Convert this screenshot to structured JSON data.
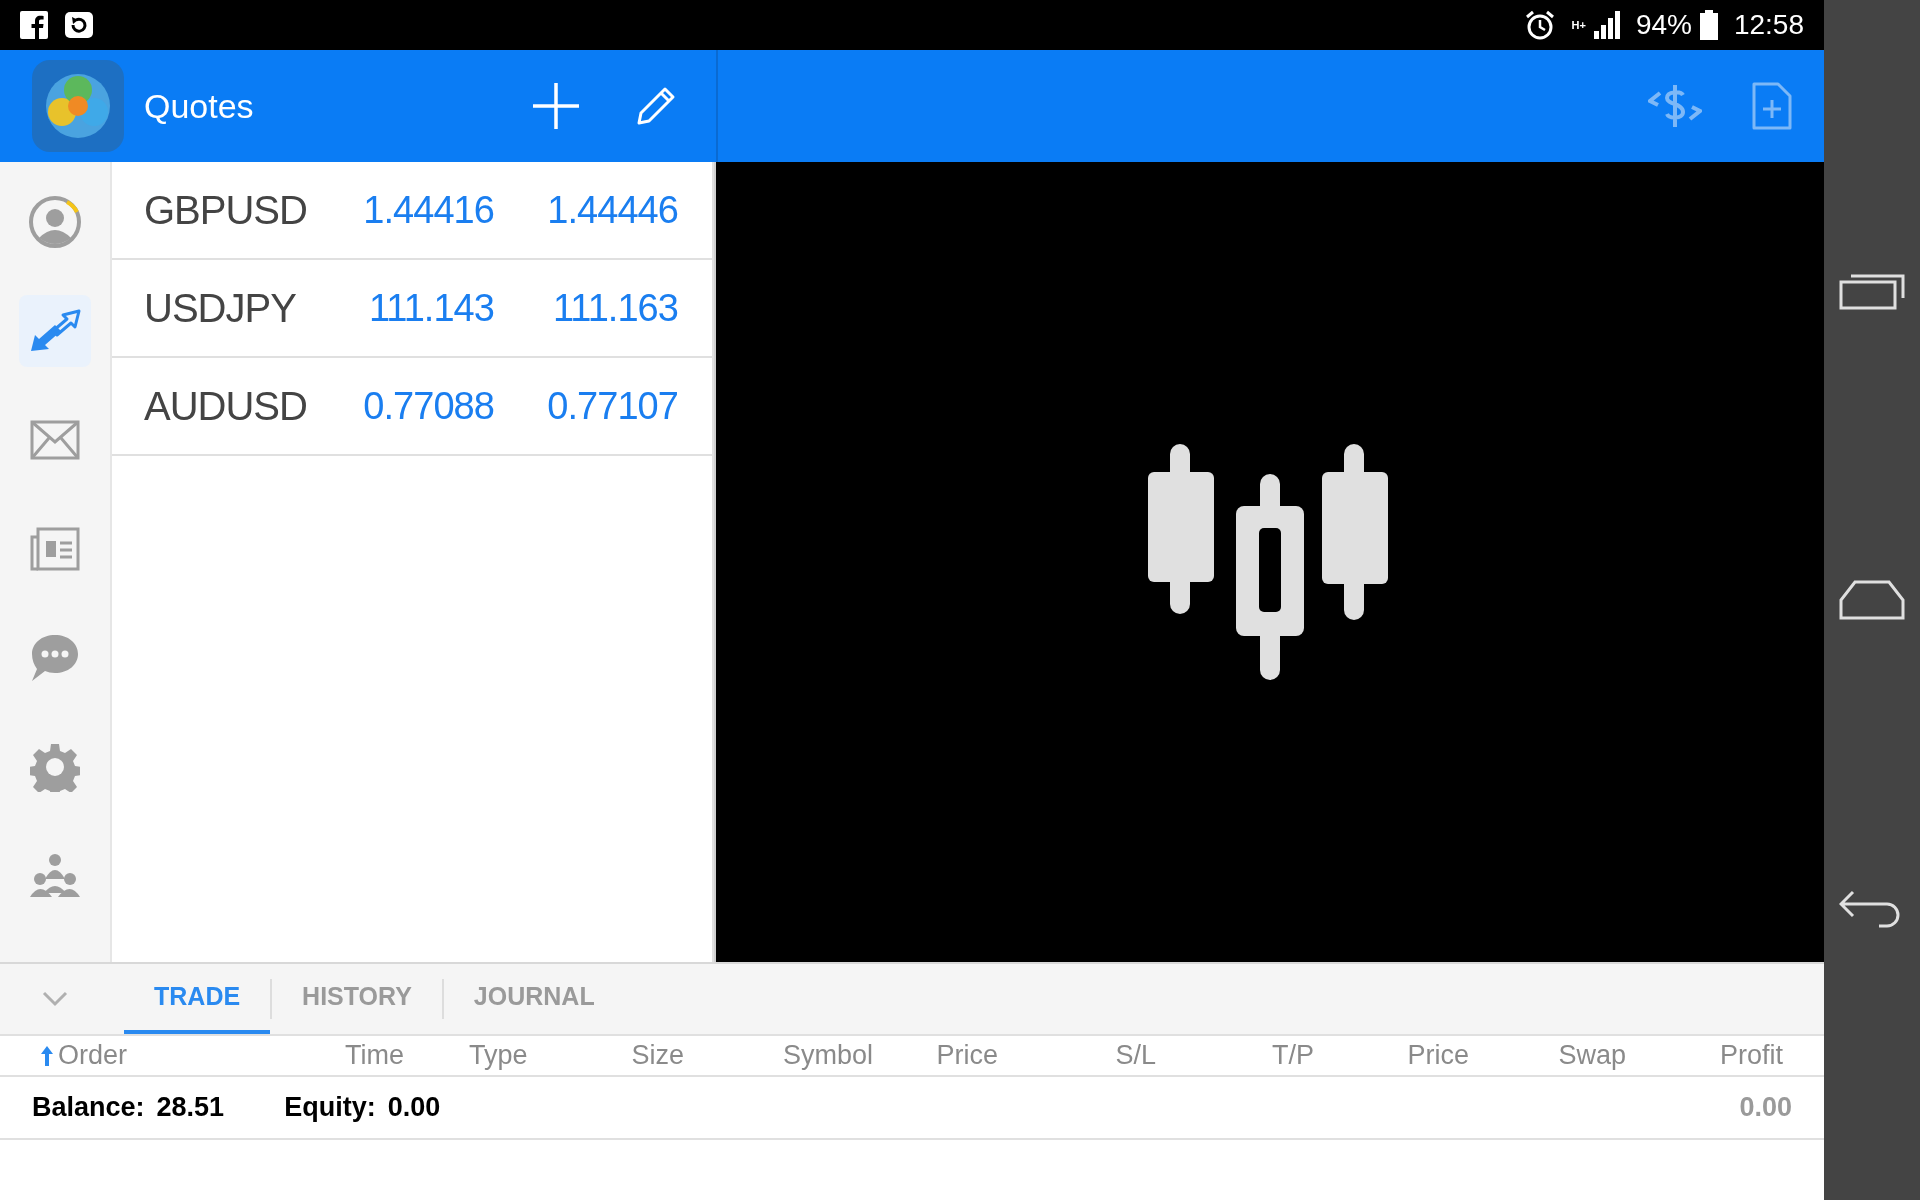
{
  "status_bar": {
    "network": "H+",
    "battery": "94%",
    "time": "12:58"
  },
  "header": {
    "title": "Quotes"
  },
  "sidebar": {
    "items": [
      {
        "kind": "account",
        "selected": false
      },
      {
        "kind": "trade",
        "selected": true
      },
      {
        "kind": "mail",
        "selected": false
      },
      {
        "kind": "news",
        "selected": false
      },
      {
        "kind": "chat",
        "selected": false
      },
      {
        "kind": "settings",
        "selected": false
      },
      {
        "kind": "community",
        "selected": false
      }
    ]
  },
  "quotes": [
    {
      "symbol": "GBPUSD",
      "bid": "1.44416",
      "ask": "1.44446"
    },
    {
      "symbol": "USDJPY",
      "bid": "111.143",
      "ask": "111.163"
    },
    {
      "symbol": "AUDUSD",
      "bid": "0.77088",
      "ask": "0.77107"
    }
  ],
  "bottom_panel": {
    "tabs": [
      {
        "label": "TRADE",
        "selected": true
      },
      {
        "label": "HISTORY",
        "selected": false
      },
      {
        "label": "JOURNAL",
        "selected": false
      }
    ],
    "columns": [
      "Order",
      "Time",
      "Type",
      "Size",
      "Symbol",
      "Price",
      "S/L",
      "T/P",
      "Price",
      "Swap",
      "Profit"
    ],
    "balance_label": "Balance:",
    "balance": "28.51",
    "equity_label": "Equity:",
    "equity": "0.00",
    "profit": "0.00"
  }
}
